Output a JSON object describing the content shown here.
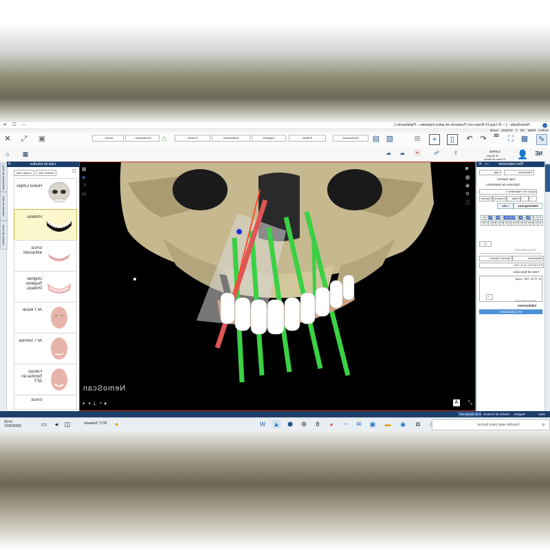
{
  "window": {
    "title": "NemoStudio – [ -- 3I Casa Dr Brown.nxf | Postarcón sin pobre Implantes – Planificación ]",
    "controls": [
      "─",
      "☐",
      "✕"
    ]
  },
  "menu": [
    "Archivo",
    "Editar",
    "Ver",
    "h",
    "Ventana",
    "Ayuda"
  ],
  "ribbon": {
    "buttons": [
      "Acción...",
      "Visualización...",
      "Prótesis",
      "Aditamentos",
      "Implantes",
      "Prótesis",
      "Extracciones"
    ],
    "badge": "3D"
  },
  "subribbon": {
    "patient_name": "Lorena",
    "patient_doctor": "Dr Brown",
    "patient_tag": "3I Caso de Merce",
    "brand": "NE",
    "tools": [
      "Tools",
      "Vistas",
      "Dr Brown",
      "Export"
    ]
  },
  "left_panel": {
    "title": "Lista de estudios",
    "btn_show_all": "Mostrar Todo",
    "btn_hide_all": "Ocultar Todo",
    "side_tabs": [
      "Árbol de Estructuras",
      "Lista de estudios",
      "Árbol de Dientes"
    ],
    "studies": [
      {
        "label": "Hueso Limpio"
      },
      {
        "label": "Prótesis"
      },
      {
        "label": "Encía extracción"
      },
      {
        "label": "Original-Superior-Prótesis"
      },
      {
        "label": "AFT Bucal"
      },
      {
        "label": "AFT Sonrisa"
      },
      {
        "label": "Foto3D Sonrisa sin AFT"
      },
      {
        "label": "Encía"
      }
    ]
  },
  "viewport": {
    "brand": "NemoScan",
    "top_icons": [
      "camera-icon",
      "grid-icon",
      "eye-icon",
      "settings-icon",
      "info-icon"
    ],
    "bottom_right_badge": "A"
  },
  "right_panel": {
    "title": "Plan tratamiento",
    "fields": {
      "tratamiento": "Tratamiento",
      "caja": "Caja",
      "superior_label": "Caja superior",
      "opciones_label": "Opciones de tratamiento",
      "opcion": "Opción de Tratamiento 1",
      "editar": "Editar",
      "expandir": "Expandir",
      "export": "Exportar"
    },
    "tabs": [
      "Odontograma",
      "Lista"
    ],
    "tooth_upper": [
      "18",
      "17",
      "16",
      "15",
      "14",
      "13",
      "12",
      "11",
      "21",
      "22",
      "23",
      "24",
      "25",
      "26",
      "27",
      "28"
    ],
    "tooth_lower": [
      "48",
      "47",
      "46",
      "45",
      "44",
      "43",
      "42",
      "41",
      "31",
      "32",
      "33",
      "34",
      "35",
      "36",
      "37",
      "38"
    ],
    "tooth_selected": [
      "16",
      "14",
      "12",
      "11",
      "21",
      "23",
      "25"
    ],
    "pre_label": "Pre-producción",
    "implant": {
      "brand": "Nobelactive",
      "type": "Tapered Titanium",
      "size": "P4.3 Ø 5.0 L 11.5 / 013"
    },
    "fase_label": "Fase de Ejecución",
    "fase_cols": [
      "Id",
      "Pf",
      "Sc",
      "Plat",
      "Longit"
    ],
    "validaciones_label": "Validaciones",
    "ver_validaciones": "Ver Validaciones"
  },
  "statusbar": {
    "tabs": [
      "Visor",
      "Diseño de Prótesis",
      "Registro",
      "3I Caso de Dr Brown.nxf"
    ]
  },
  "taskbar": {
    "search_placeholder": "Escribe aquí para buscar",
    "weather": "26°C  Soleado",
    "time": "14:30",
    "date": "29/06/2021"
  }
}
